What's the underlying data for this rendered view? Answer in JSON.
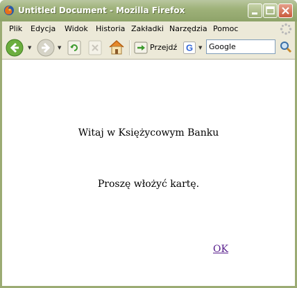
{
  "window": {
    "title": "Untitled Document - Mozilla Firefox",
    "icons": {
      "app": "firefox-icon",
      "minimize": "minimize-icon",
      "maximize": "maximize-icon",
      "close": "close-icon"
    }
  },
  "menubar": {
    "items": [
      "Plik",
      "Edycja",
      "Widok",
      "Historia",
      "Zakładki",
      "Narzędzia",
      "Pomoc"
    ]
  },
  "navbar": {
    "icons": [
      "back-arrow-icon",
      "forward-arrow-icon",
      "reload-icon",
      "stop-icon",
      "home-icon",
      "go-icon",
      "google-search-icon",
      "magnifier-icon"
    ],
    "go_label": "Przejdź",
    "search_value": "Google"
  },
  "page": {
    "greeting": "Witaj w Księżycowym Banku",
    "prompt": "Proszę włożyć kartę.",
    "ok_link": "OK"
  },
  "colors": {
    "title_bar": "#9fb27a",
    "chrome": "#ece9d8",
    "link_visited": "#551a8b"
  }
}
